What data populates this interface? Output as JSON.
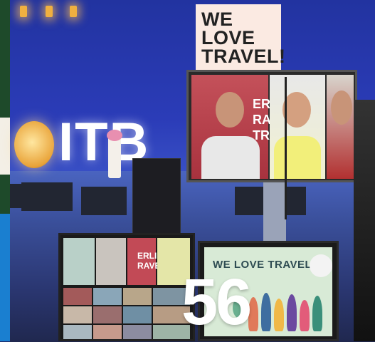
{
  "photo": {
    "banner_lines": [
      "WE",
      "LOVE",
      "TRAVEL!"
    ],
    "stage_logo": "ITB",
    "back_screen_text": [
      "ERLI",
      "RAVE",
      "TRA"
    ],
    "left_screen_text": [
      "ERLI",
      "RAVE"
    ],
    "right_screen_title": "WE LOVE TRAVEL!",
    "page_number": "56"
  },
  "colors": {
    "stage_blue": "#2b3cb8",
    "banner_bg": "#fbeae2",
    "overlay_number": "#ffffff",
    "screen_green": "#d8ead6",
    "side_blue": "#1a7fd0"
  }
}
